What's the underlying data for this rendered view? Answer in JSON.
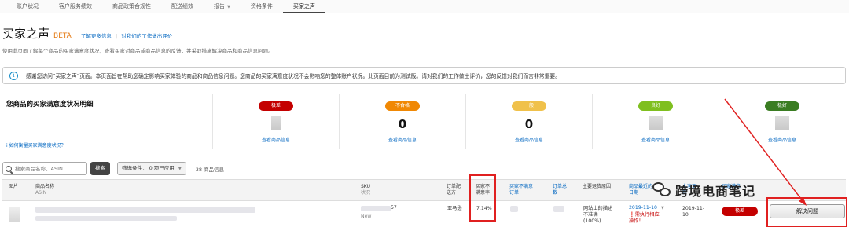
{
  "topnav": {
    "tabs": [
      {
        "label": "账户状况"
      },
      {
        "label": "客户服务绩效"
      },
      {
        "label": "商品政策合规性"
      },
      {
        "label": "配送绩效"
      },
      {
        "label": "报告"
      },
      {
        "label": "资格条件"
      },
      {
        "label": "买家之声"
      }
    ],
    "active_index": 6
  },
  "header": {
    "title": "买家之声",
    "beta": "BETA",
    "link_learn_more": "了解更多信息",
    "link_separator": "|",
    "link_feedback": "对我们的工作做出评价",
    "description": "使用此页面了解每个商品的买家满意度状况，查看买家对商品或商品信息的反馈，并采取措施解决商品和商品信息问题。"
  },
  "notice": {
    "icon": "i",
    "text": "感谢您访问“买家之声”页面。本页面旨在帮助您确定影响买家体验的商品和商品信息问题。您商品的买家满意度状况不会影响您的整体账户状况。此页面目前为测试版。请对我们的工作做出评价，您的反馈对我们而言非常重要。"
  },
  "summary": {
    "title": "您商品的买家满意度状况明细",
    "help_link": "如何衡量买家满意度状况？",
    "ratings": [
      {
        "label": "极差",
        "color": "#c40000",
        "count": null,
        "link": "查看商品信息"
      },
      {
        "label": "不合格",
        "color": "#f08804",
        "count": "0",
        "link": "查看商品信息"
      },
      {
        "label": "一般",
        "color": "#f0c14b",
        "count": "0",
        "link": "查看商品信息"
      },
      {
        "label": "良好",
        "color": "#7fbf1f",
        "count": null,
        "link": "查看商品信息"
      },
      {
        "label": "极好",
        "color": "#3a7d22",
        "count": null,
        "link": "查看商品信息"
      }
    ]
  },
  "filters": {
    "search_placeholder": "搜索商品名称、ASIN",
    "search_button": "搜索",
    "filter_label": "筛选条件： 0 项已应用",
    "product_count": "38 商品信息"
  },
  "table": {
    "headers": {
      "image": "图片",
      "name": "商品名称",
      "name_sub": "ASIN",
      "sku": "SKU",
      "sku_sub": "状况",
      "fulfillment_1": "订单配",
      "fulfillment_2": "送方",
      "dissat_rate_1": "买家不",
      "dissat_rate_2": "满意率",
      "dissat_orders_1": "买家不满意",
      "dissat_orders_2": "订单",
      "orders_1": "订单总",
      "orders_2": "数",
      "return_reason": "主要退货原因",
      "last_1": "商品最近的",
      "last_2": "日期",
      "last2_1": "上次更",
      "last2_2": "新",
      "status_1": "买家满意"
    },
    "row": {
      "sku": "57",
      "condition": "New",
      "fulfillment": "亚马逊",
      "dissat_rate": "7.14%",
      "return_reason_1": "网站上的描述",
      "return_reason_2": "不准确",
      "return_reason_3": "(100%)",
      "date": "2019-11-10",
      "action_1": "需执行相应",
      "action_2": "操作！",
      "updated_1": "2019-11-",
      "updated_2": "10",
      "badge": "极差",
      "resolve_button": "解决问题"
    }
  },
  "watermark": {
    "text": "跨境电商笔记"
  }
}
